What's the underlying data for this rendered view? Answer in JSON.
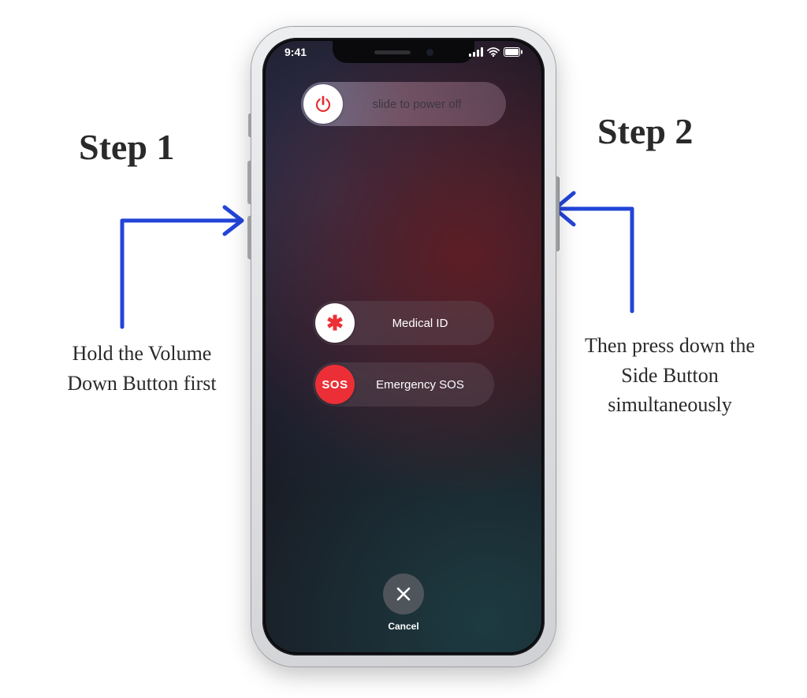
{
  "annotations": {
    "step1": {
      "title": "Step 1",
      "text": "Hold the Volume Down Button first"
    },
    "step2": {
      "title": "Step 2",
      "text": "Then press down the Side Button simultaneously"
    }
  },
  "phone": {
    "status": {
      "time": "9:41"
    },
    "sliders": {
      "power_off": {
        "label": "slide to power off"
      },
      "medical": {
        "label": "Medical ID",
        "knob_symbol": "✱"
      },
      "sos": {
        "label": "Emergency SOS",
        "knob_text": "SOS"
      }
    },
    "cancel": {
      "label": "Cancel"
    }
  },
  "icons": {
    "power": "power-icon",
    "asterisk": "asterisk-icon",
    "close": "close-icon"
  },
  "colors": {
    "annotation_arrow": "#2244d8",
    "sos_red": "#ec2f36",
    "power_red": "#e22f33"
  }
}
